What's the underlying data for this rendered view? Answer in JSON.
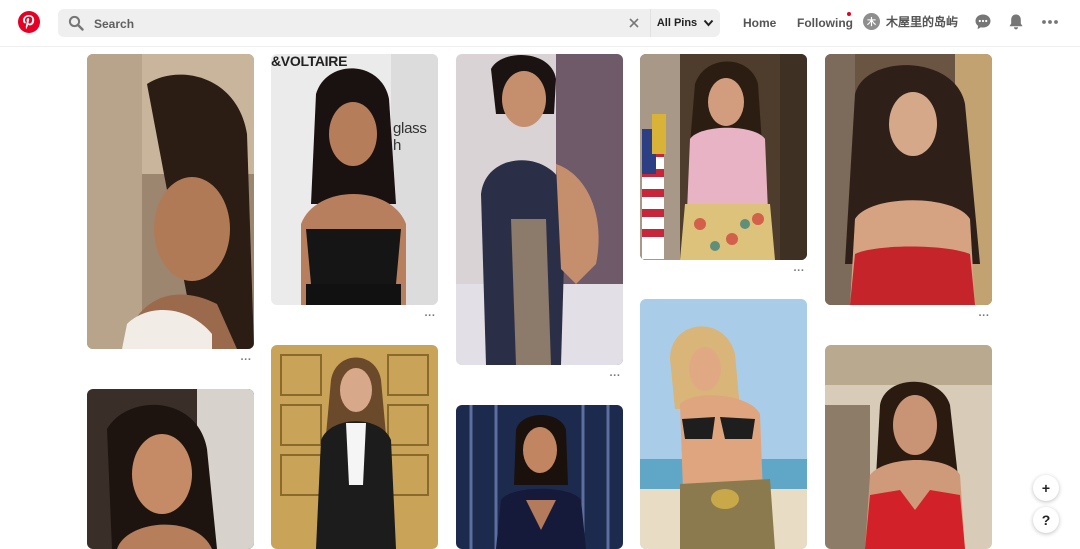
{
  "header": {
    "brand_icon": "pinterest-logo",
    "search": {
      "placeholder": "Search",
      "value": ""
    },
    "scope": {
      "label": "All Pins",
      "icon": "chevron-down-icon"
    },
    "nav": {
      "home": "Home",
      "following": "Following"
    },
    "profile": {
      "avatar_letter": "木",
      "name": "木屋里的岛屿"
    },
    "icons": [
      "message-icon",
      "bell-icon",
      "more-icon"
    ],
    "accent_color": "#e60023"
  },
  "pins": [
    {
      "id": "pin-1",
      "more": "···"
    },
    {
      "id": "pin-2",
      "more": "···",
      "overlay_text": "&VOLTAIRE",
      "overlay_text_2": "glass h"
    },
    {
      "id": "pin-3",
      "more": "···"
    },
    {
      "id": "pin-4",
      "more": "···"
    },
    {
      "id": "pin-5",
      "more": "···"
    },
    {
      "id": "pin-6"
    },
    {
      "id": "pin-7"
    },
    {
      "id": "pin-8"
    },
    {
      "id": "pin-9"
    },
    {
      "id": "pin-10"
    }
  ],
  "floating": {
    "add_label": "+",
    "help_label": "?"
  }
}
